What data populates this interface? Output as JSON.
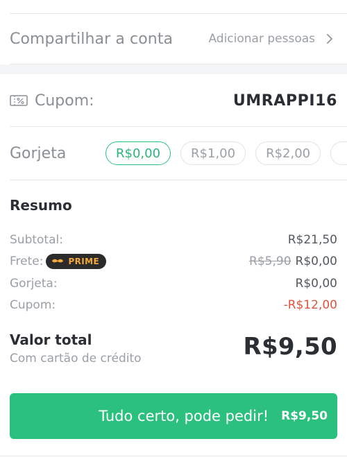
{
  "share": {
    "title": "Compartilhar a conta",
    "action_label": "Adicionar pessoas",
    "icon": "chevron-right-icon"
  },
  "coupon": {
    "label": "Cupom:",
    "code": "UMRAPPI16",
    "icon": "percent-ticket-icon"
  },
  "tip": {
    "label": "Gorjeta",
    "options": [
      "R$0,00",
      "R$1,00",
      "R$2,00"
    ],
    "selected_index": 0
  },
  "summary": {
    "title": "Resumo",
    "subtotal_label": "Subtotal:",
    "subtotal_value": "R$21,50",
    "delivery_label": "Frete:",
    "delivery_badge": "PRIME",
    "delivery_old_value": "R$5,90",
    "delivery_value": "R$0,00",
    "tip_label": "Gorjeta:",
    "tip_value": "R$0,00",
    "coupon_label": "Cupom:",
    "coupon_value": "-R$12,00"
  },
  "total": {
    "label": "Valor total",
    "payment_method": "Com cartão de crédito",
    "value": "R$9,50"
  },
  "cta": {
    "label": "Tudo certo, pode pedir!",
    "price": "R$9,50"
  },
  "colors": {
    "accent": "#2cc07f",
    "negative": "#e0533d",
    "prime_badge": "#2b2b2b",
    "prime_text": "#f3a83b"
  }
}
